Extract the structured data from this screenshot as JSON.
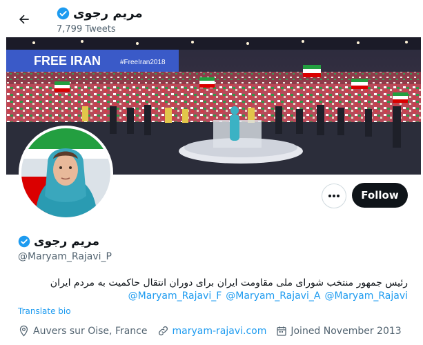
{
  "header": {
    "title": "مریم رجوی",
    "tweet_count": "7,799 Tweets"
  },
  "banner": {
    "sign_text": "FREE IRAN",
    "sign_hashtag": "#FreeIran2018"
  },
  "actions": {
    "follow_label": "Follow"
  },
  "profile": {
    "name": "مریم رجوی",
    "handle": "@Maryam_Rajavi_P",
    "bio": "رئیس جمهور منتخب شورای ملی مقاومت ایران برای دوران انتقال حاکمیت به مردم ایران",
    "mentions": [
      "@Maryam_Rajavi_F",
      "@Maryam_Rajavi_A",
      "@Maryam_Rajavi"
    ],
    "translate_label": "Translate bio",
    "location": "Auvers sur Oise, France",
    "website": "maryam-rajavi.com",
    "joined": "Joined November 2013"
  },
  "colors": {
    "accent": "#1d9bf0",
    "text": "#0f1419",
    "muted": "#536471",
    "follow_bg": "#0f1419"
  }
}
